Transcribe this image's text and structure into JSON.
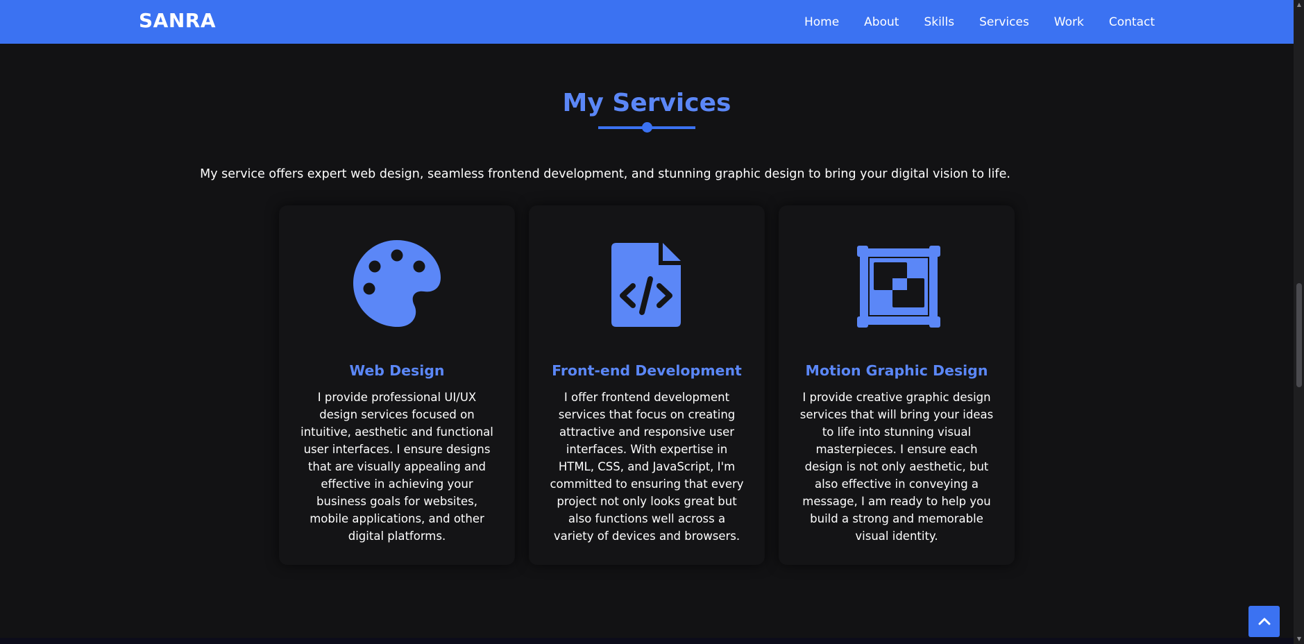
{
  "navbar": {
    "brand": "SANRA",
    "links": [
      "Home",
      "About",
      "Skills",
      "Services",
      "Work",
      "Contact"
    ],
    "background": "#3b72f2"
  },
  "services": {
    "title": "My Services",
    "intro": "My service offers expert web design, seamless frontend development, and stunning graphic design to bring your digital vision to life.",
    "cards": [
      {
        "icon": "palette-icon",
        "title": "Web Design",
        "text": "I provide professional UI/UX design services focused on intuitive, aesthetic and functional user interfaces. I ensure designs that are visually appealing and effective in achieving your business goals for websites, mobile applications, and other digital platforms."
      },
      {
        "icon": "code-file-icon",
        "title": "Front-end Development",
        "text": "I offer frontend development services that focus on creating attractive and responsive user interfaces. With expertise in HTML, CSS, and JavaScript, I'm committed to ensuring that every project not only looks great but also functions well across a variety of devices and browsers."
      },
      {
        "icon": "vector-square-icon",
        "title": "Motion Graphic Design",
        "text": "I provide creative graphic design services that will bring your ideas to life into stunning visual masterpieces. I ensure each design is not only aesthetic, but also effective in conveying a message, I am ready to help you build a strong and memorable visual identity."
      }
    ]
  },
  "back_to_top": {
    "icon": "chevron-up-icon"
  },
  "colors": {
    "accent": "#5b87f7",
    "primary": "#3b72f2",
    "background": "#121214"
  }
}
